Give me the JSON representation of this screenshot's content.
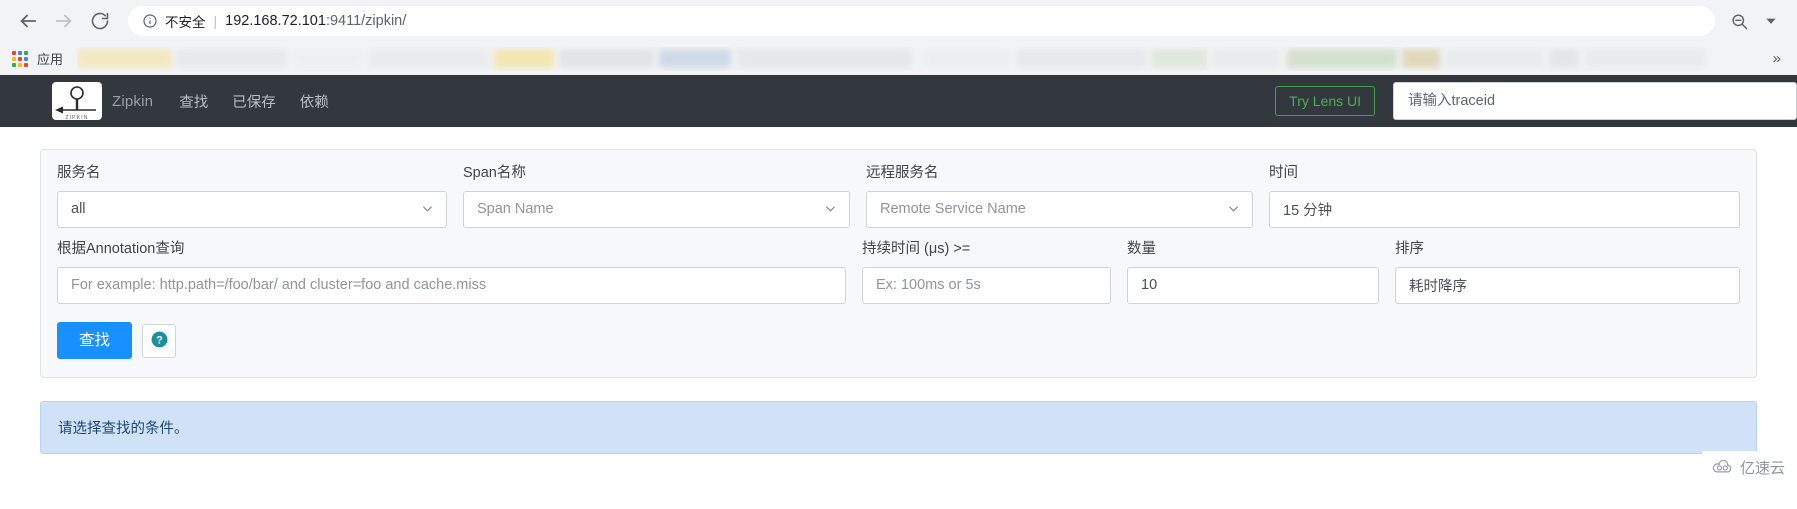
{
  "browser": {
    "back_icon": "arrow-left-icon",
    "forward_icon": "arrow-right-icon",
    "reload_icon": "reload-icon",
    "security_info_icon": "info-circle-icon",
    "security_label": "不安全",
    "security_divider": "|",
    "url_host": "192.168.72.101",
    "url_rest": ":9411/zipkin/",
    "zoom_out_icon": "zoom-out-icon",
    "menu_caret_icon": "chevron-down-icon",
    "bookmarks": {
      "apps_icon": "apps-grid-icon",
      "apps_label": "应用",
      "overflow_label": "»"
    }
  },
  "navbar": {
    "logo_icon": "zipkin-logo-icon",
    "brand": "Zipkin",
    "links": [
      {
        "label": "查找"
      },
      {
        "label": "已保存"
      },
      {
        "label": "依赖"
      }
    ],
    "lens_button": "Try Lens UI",
    "traceid_placeholder": "请输入traceid",
    "traceid_value": ""
  },
  "search_form": {
    "fields": {
      "service": {
        "label": "服务名",
        "value": "all",
        "caret_icon": "chevron-down-icon"
      },
      "span": {
        "label": "Span名称",
        "value": "Span Name",
        "is_placeholder": true,
        "caret_icon": "chevron-down-icon"
      },
      "remote_service": {
        "label": "远程服务名",
        "value": "Remote Service Name",
        "is_placeholder": true,
        "caret_icon": "chevron-down-icon"
      },
      "time": {
        "label": "时间",
        "value": "15 分钟"
      },
      "annotation": {
        "label": "根据Annotation查询",
        "placeholder": "For example: http.path=/foo/bar/ and cluster=foo and cache.miss",
        "value": ""
      },
      "duration": {
        "label": "持续时间 (μs) >=",
        "placeholder": "Ex: 100ms or 5s",
        "value": ""
      },
      "count": {
        "label": "数量",
        "value": "10"
      },
      "sort": {
        "label": "排序",
        "value": "耗时降序"
      }
    },
    "find_button": "查找",
    "help_button_icon": "question-mark-circle-icon"
  },
  "alert": {
    "message": "请选择查找的条件。"
  },
  "watermark": {
    "icon": "cloud-icon",
    "text": "亿速云"
  },
  "colors": {
    "navbar_bg": "#32383e",
    "primary_button": "#1890ff",
    "lens_green": "#4caf50",
    "alert_bg": "#cfe2f8",
    "help_teal": "#1b8fa0"
  }
}
